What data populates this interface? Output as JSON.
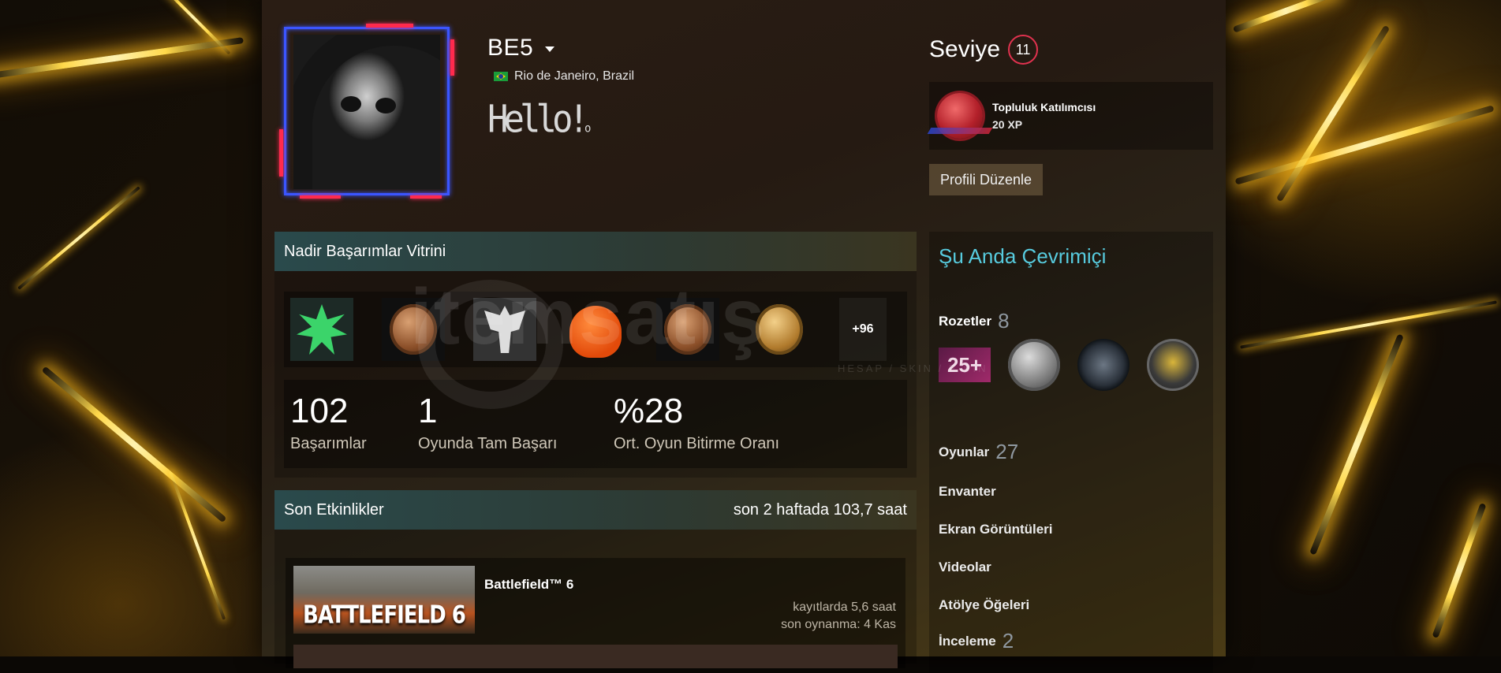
{
  "profile": {
    "persona_name": "BE5",
    "location": "Rio de Janeiro, Brazil",
    "summary": "Hello!",
    "summary_suffix": "o",
    "level_label": "Seviye",
    "level_value": "11",
    "favorite_badge": {
      "name": "Topluluk Katılımcısı",
      "xp": "20 XP"
    },
    "edit_button": "Profili Düzenle"
  },
  "showcase": {
    "title": "Nadir Başarımlar Vitrini",
    "more_label": "+96",
    "stats": [
      {
        "value": "102",
        "label": "Başarımlar"
      },
      {
        "value": "1",
        "label": "Oyunda Tam Başarı"
      },
      {
        "value": "%28",
        "label": "Ort. Oyun Bitirme Oranı"
      }
    ]
  },
  "recent": {
    "title": "Son Etkinlikler",
    "summary": "son 2 haftada 103,7 saat",
    "game": {
      "name": "Battlefield™ 6",
      "capsule_text": "BATTLEFIELD 6",
      "hours_on_record": "kayıtlarda 5,6 saat",
      "last_played": "son oynanma: 4 Kas"
    }
  },
  "sidebar": {
    "status": "Şu Anda Çevrimiçi",
    "badges_label": "Rozetler",
    "badges_count": "8",
    "badge_25_label": "25+",
    "games_label": "Oyunlar",
    "games_count": "27",
    "inventory": "Envanter",
    "screenshots": "Ekran Görüntüleri",
    "videos": "Videolar",
    "workshop": "Atölye Öğeleri",
    "reviews_label": "İnceleme",
    "reviews_count": "2"
  },
  "watermark": {
    "brand": "itemsatış",
    "tagline": "HESAP / SKIN / E-PİN"
  },
  "colors": {
    "accent_online": "#57cbde",
    "level_ring": "#e1324f",
    "frame_blue": "#3b55ff",
    "frame_red": "#ff2a4d"
  },
  "icons": [
    "brazil-flag-icon",
    "dropdown-caret-icon",
    "community-badge-icon"
  ]
}
